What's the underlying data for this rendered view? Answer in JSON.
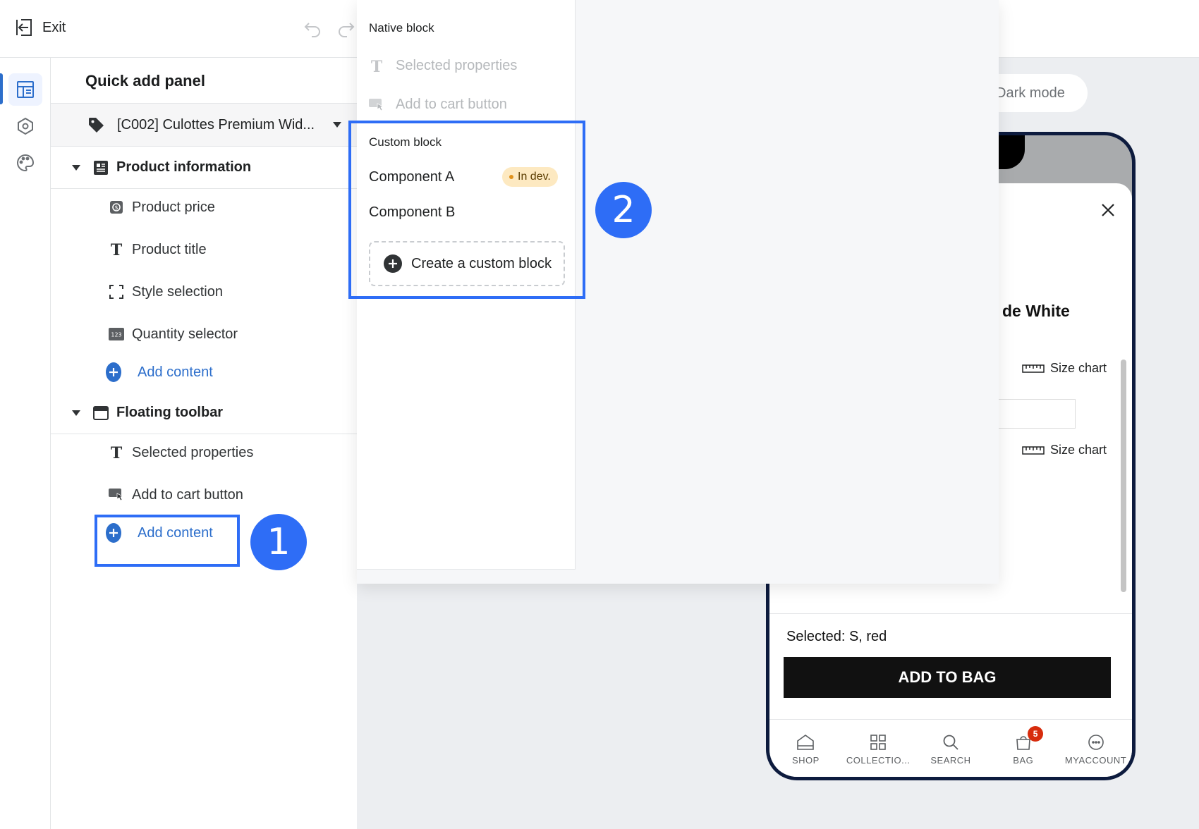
{
  "topbar": {
    "exit_label": "Exit"
  },
  "panel": {
    "title": "Quick add panel",
    "product_select": "[C002] Culottes Premium Wid...",
    "sections": {
      "product_information": {
        "label": "Product information",
        "items": [
          "Product price",
          "Product title",
          "Style selection",
          "Quantity selector"
        ],
        "add_label": "Add content"
      },
      "floating_toolbar": {
        "label": "Floating toolbar",
        "items": [
          "Selected properties",
          "Add to cart button"
        ],
        "add_label": "Add content"
      }
    }
  },
  "popup": {
    "native_heading": "Native block",
    "native_items": [
      "Selected properties",
      "Add to cart button"
    ],
    "custom_heading": "Custom block",
    "components": [
      "Component A",
      "Component B"
    ],
    "in_dev_badge": "In dev.",
    "create_label": "Create a custom block"
  },
  "preview": {
    "dark_mode_label": "Dark mode",
    "product_heading_fragment": "de White",
    "size_chart_label": "Size chart",
    "selected_text": "Selected: S, red",
    "add_to_bag": "ADD TO BAG",
    "tabs": [
      "SHOP",
      "COLLECTIO...",
      "SEARCH",
      "BAG",
      "MYACCOUNT"
    ],
    "bag_count": "5"
  },
  "annotations": {
    "marker_1": "1",
    "marker_2": "2"
  },
  "colors": {
    "accent": "#2c6ecb",
    "annotation": "#2e6df6",
    "badge": "#fde9c1",
    "phone_frame": "#0d1b3e"
  }
}
